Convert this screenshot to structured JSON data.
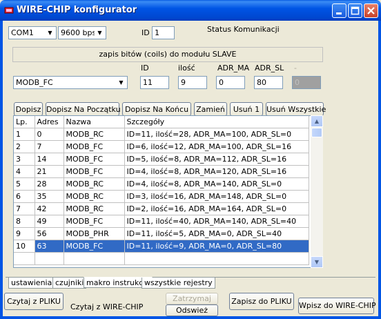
{
  "window": {
    "title": "WIRE-CHIP konfigurator"
  },
  "connection": {
    "port": "COM1",
    "baud": "9600 bps",
    "id_label": "ID",
    "id_value": "1",
    "status_label": "Status Komunikacji"
  },
  "write_panel": {
    "header": "zapis bitów (coils) do modułu SLAVE",
    "function": "MODB_FC",
    "labels": {
      "id": "ID",
      "count": "ilość",
      "adr_ma": "ADR_MA",
      "adr_sl": "ADR_SL",
      "extra": "-"
    },
    "values": {
      "id": "11",
      "count": "9",
      "adr_ma": "0",
      "adr_sl": "80",
      "extra": "0"
    }
  },
  "toolbar": {
    "add": "Dopisz",
    "add_start": "Dopisz Na Początku",
    "add_end": "Dopisz Na Końcu",
    "replace": "Zamień",
    "remove_one": "Usuń 1",
    "remove_all": "Usuń Wszystkie"
  },
  "table": {
    "columns": [
      "Lp.",
      "Adres",
      "Nazwa",
      "Szczegóły"
    ],
    "rows": [
      {
        "lp": "1",
        "adres": "0",
        "nazwa": "MODB_RC",
        "szczegoly": "ID=11, ilość=28, ADR_MA=100, ADR_SL=0"
      },
      {
        "lp": "2",
        "adres": "7",
        "nazwa": "MODB_FC",
        "szczegoly": "ID=6, ilość=12, ADR_MA=100, ADR_SL=16"
      },
      {
        "lp": "3",
        "adres": "14",
        "nazwa": "MODB_FC",
        "szczegoly": "ID=5, ilość=8, ADR_MA=112, ADR_SL=16"
      },
      {
        "lp": "4",
        "adres": "21",
        "nazwa": "MODB_FC",
        "szczegoly": "ID=4, ilość=8, ADR_MA=120, ADR_SL=16"
      },
      {
        "lp": "5",
        "adres": "28",
        "nazwa": "MODB_RC",
        "szczegoly": "ID=4, ilość=8, ADR_MA=140, ADR_SL=0"
      },
      {
        "lp": "6",
        "adres": "35",
        "nazwa": "MODB_RC",
        "szczegoly": "ID=3, ilość=16, ADR_MA=148, ADR_SL=0"
      },
      {
        "lp": "7",
        "adres": "42",
        "nazwa": "MODB_RC",
        "szczegoly": "ID=2, ilość=16, ADR_MA=164, ADR_SL=0"
      },
      {
        "lp": "8",
        "adres": "49",
        "nazwa": "MODB_FC",
        "szczegoly": "ID=11, ilość=40, ADR_MA=140, ADR_SL=40"
      },
      {
        "lp": "9",
        "adres": "56",
        "nazwa": "MODB_PHR",
        "szczegoly": "ID=11, ilość=5, ADR_MA=0, ADR_SL=40"
      },
      {
        "lp": "10",
        "adres": "63",
        "nazwa": "MODB_FC",
        "szczegoly": "ID=11, ilość=9, ADR_MA=0, ADR_SL=80"
      }
    ],
    "selected_row": 10
  },
  "tabs": [
    "ustawienia",
    "czujniki",
    "makro instrukcje",
    "wszystkie rejestry"
  ],
  "active_tab": "makro instrukcje",
  "bottom": {
    "read_file": "Czytaj z PLIKU",
    "read_chip": "Czytaj z WIRE-CHIP",
    "stop": "Zatrzymaj",
    "refresh": "Odswież",
    "save_file": "Zapisz do PLIKU",
    "write_chip": "Wpisz do WIRE-CHIP"
  },
  "colors": {
    "titlebar": "#0055e5",
    "selection": "#316ac5",
    "face": "#ece9d8"
  },
  "icons": [
    "app-icon",
    "minimize-icon",
    "maximize-icon",
    "close-icon",
    "dropdown-arrow-icon",
    "scroll-up-icon",
    "scroll-down-icon"
  ]
}
